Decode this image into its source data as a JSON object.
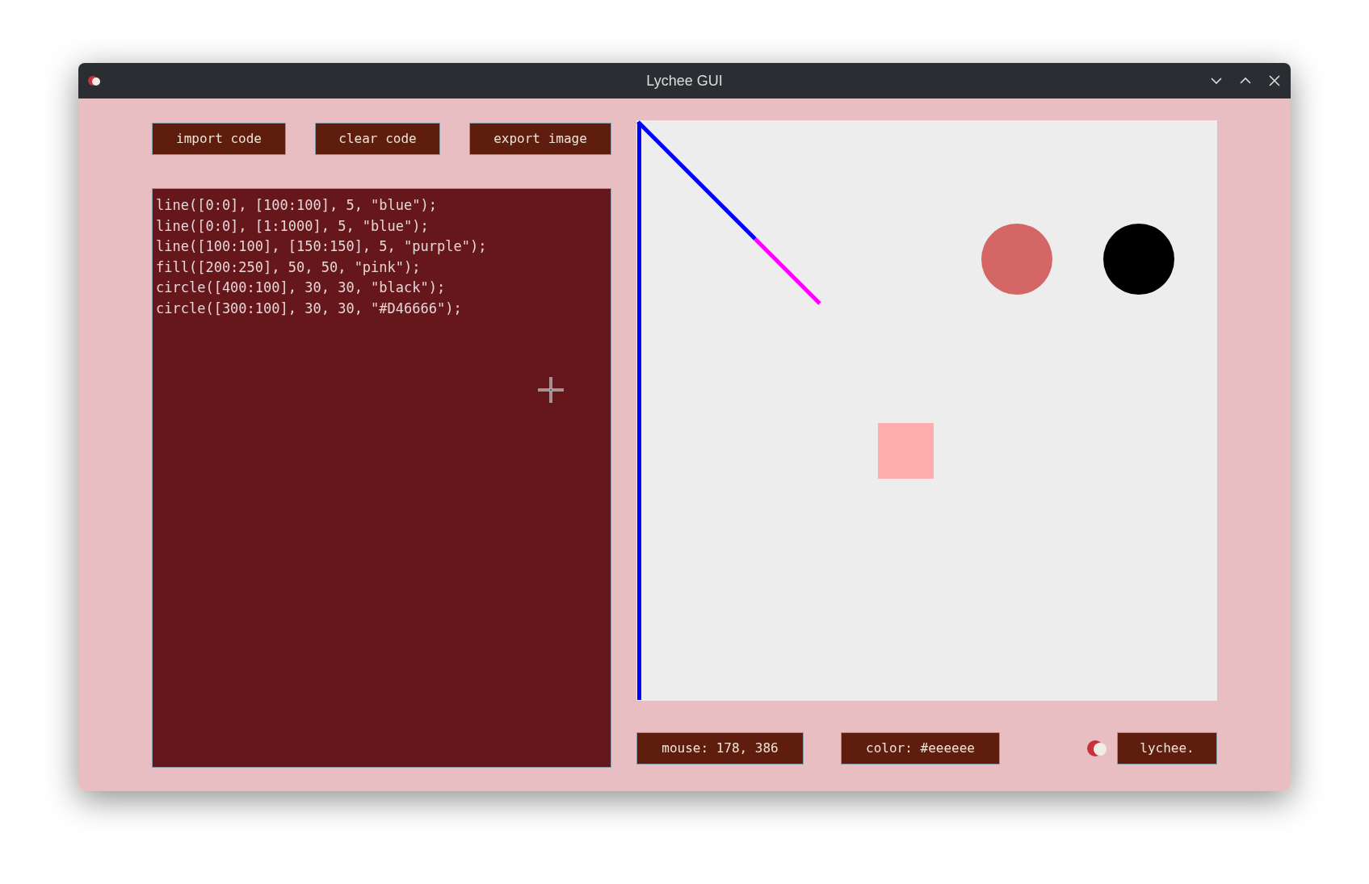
{
  "window": {
    "title": "Lychee GUI"
  },
  "toolbar": [
    "import code",
    "clear code",
    "export image"
  ],
  "editor": {
    "lines": [
      "line([0:0], [100:100], 5, \"blue\");",
      "line([0:0], [1:1000], 5, \"blue\");",
      "line([100:100], [150:150], 5, \"purple\");",
      "fill([200:250], 50, 50, \"pink\");",
      "circle([400:100], 30, 30, \"black\");",
      "circle([300:100], 30, 30, \"#D46666\");"
    ]
  },
  "canvas": {
    "shapes": [
      {
        "kind": "line",
        "color": "#0000ff"
      },
      {
        "kind": "line",
        "color": "#0000ff"
      },
      {
        "kind": "line",
        "color": "#ff00ff"
      },
      {
        "kind": "rect",
        "color": "#ffadad"
      },
      {
        "kind": "circle",
        "color": "#000000"
      },
      {
        "kind": "circle",
        "color": "#d46666"
      }
    ]
  },
  "status_bar": {
    "mouse": "mouse: 178, 386",
    "color_reading": "color: #eeeeee",
    "brand": "lychee."
  }
}
